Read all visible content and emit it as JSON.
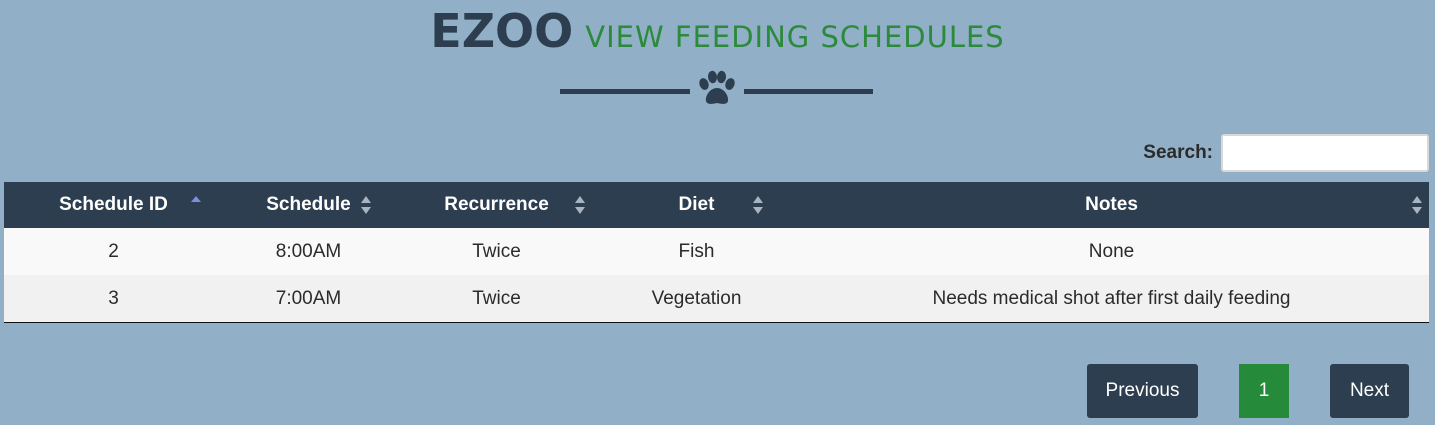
{
  "header": {
    "brand": "EZOO",
    "subtitle": "VIEW FEEDING SCHEDULES"
  },
  "search": {
    "label": "Search:",
    "value": ""
  },
  "table": {
    "columns": [
      {
        "label": "Schedule ID",
        "sort": "ascending"
      },
      {
        "label": "Schedule",
        "sort": "none"
      },
      {
        "label": "Recurrence",
        "sort": "none"
      },
      {
        "label": "Diet",
        "sort": "none"
      },
      {
        "label": "Notes",
        "sort": "none"
      }
    ],
    "rows": [
      {
        "id": "2",
        "schedule": "8:00AM",
        "recurrence": "Twice",
        "diet": "Fish",
        "notes": "None"
      },
      {
        "id": "3",
        "schedule": "7:00AM",
        "recurrence": "Twice",
        "diet": "Vegetation",
        "notes": "Needs medical shot after first daily feeding"
      }
    ]
  },
  "pagination": {
    "previous_label": "Previous",
    "current_page": "1",
    "next_label": "Next"
  },
  "colors": {
    "background": "#91afc6",
    "navy": "#2c3e50",
    "green": "#2c8a3c",
    "sort_active": "#7d8fe0"
  },
  "icons": {
    "divider": "paw-icon",
    "sort_active": "sort-asc-icon",
    "sort_inactive": "sort-both-icon"
  }
}
